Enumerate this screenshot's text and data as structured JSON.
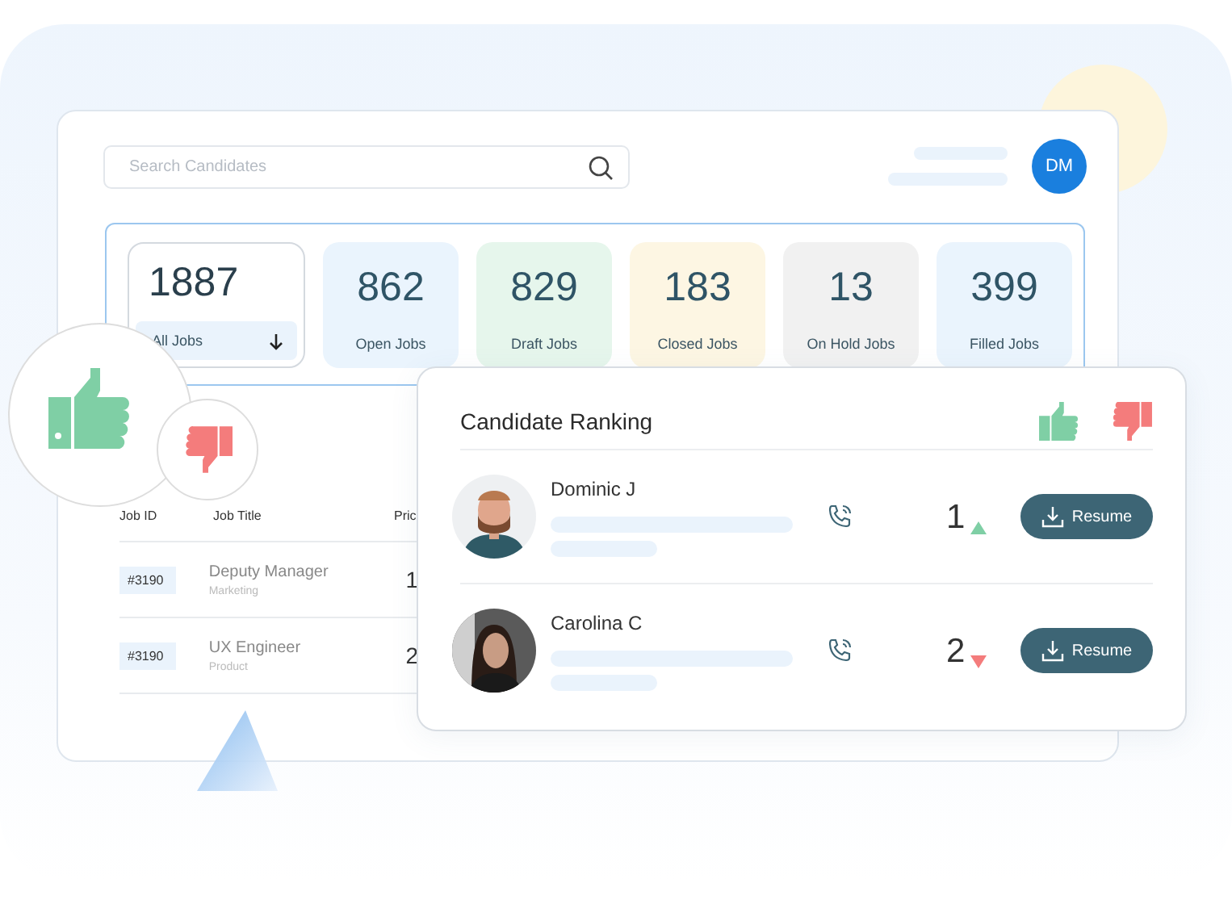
{
  "search": {
    "placeholder": "Search Candidates"
  },
  "user": {
    "initials": "DM"
  },
  "stats": [
    {
      "count": "1887",
      "label": "All Jobs",
      "selected": true,
      "color": "#ffffff"
    },
    {
      "count": "862",
      "label": "Open Jobs",
      "selected": false,
      "color": "#eaf4fd"
    },
    {
      "count": "829",
      "label": "Draft Jobs",
      "selected": false,
      "color": "#e6f6ec"
    },
    {
      "count": "183",
      "label": "Closed Jobs",
      "selected": false,
      "color": "#fdf6e3"
    },
    {
      "count": "13",
      "label": "On Hold Jobs",
      "selected": false,
      "color": "#f1f1f1"
    },
    {
      "count": "399",
      "label": "Filled Jobs",
      "selected": false,
      "color": "#eaf4fd"
    }
  ],
  "table": {
    "columns": [
      "Job ID",
      "Job Title",
      "Pric"
    ],
    "rows": [
      {
        "id": "#3190",
        "title": "Deputy Manager",
        "department": "Marketing",
        "column_3": "1"
      },
      {
        "id": "#3190",
        "title": "UX Engineer",
        "department": "Product",
        "column_3": "2"
      }
    ]
  },
  "ranking": {
    "title": "Candidate Ranking",
    "candidates": [
      {
        "name": "Dominic J",
        "rank": "1",
        "kind": "up",
        "button": "Resume"
      },
      {
        "name": "Carolina C",
        "rank": "2",
        "kind": "down",
        "button": "Resume"
      }
    ]
  }
}
